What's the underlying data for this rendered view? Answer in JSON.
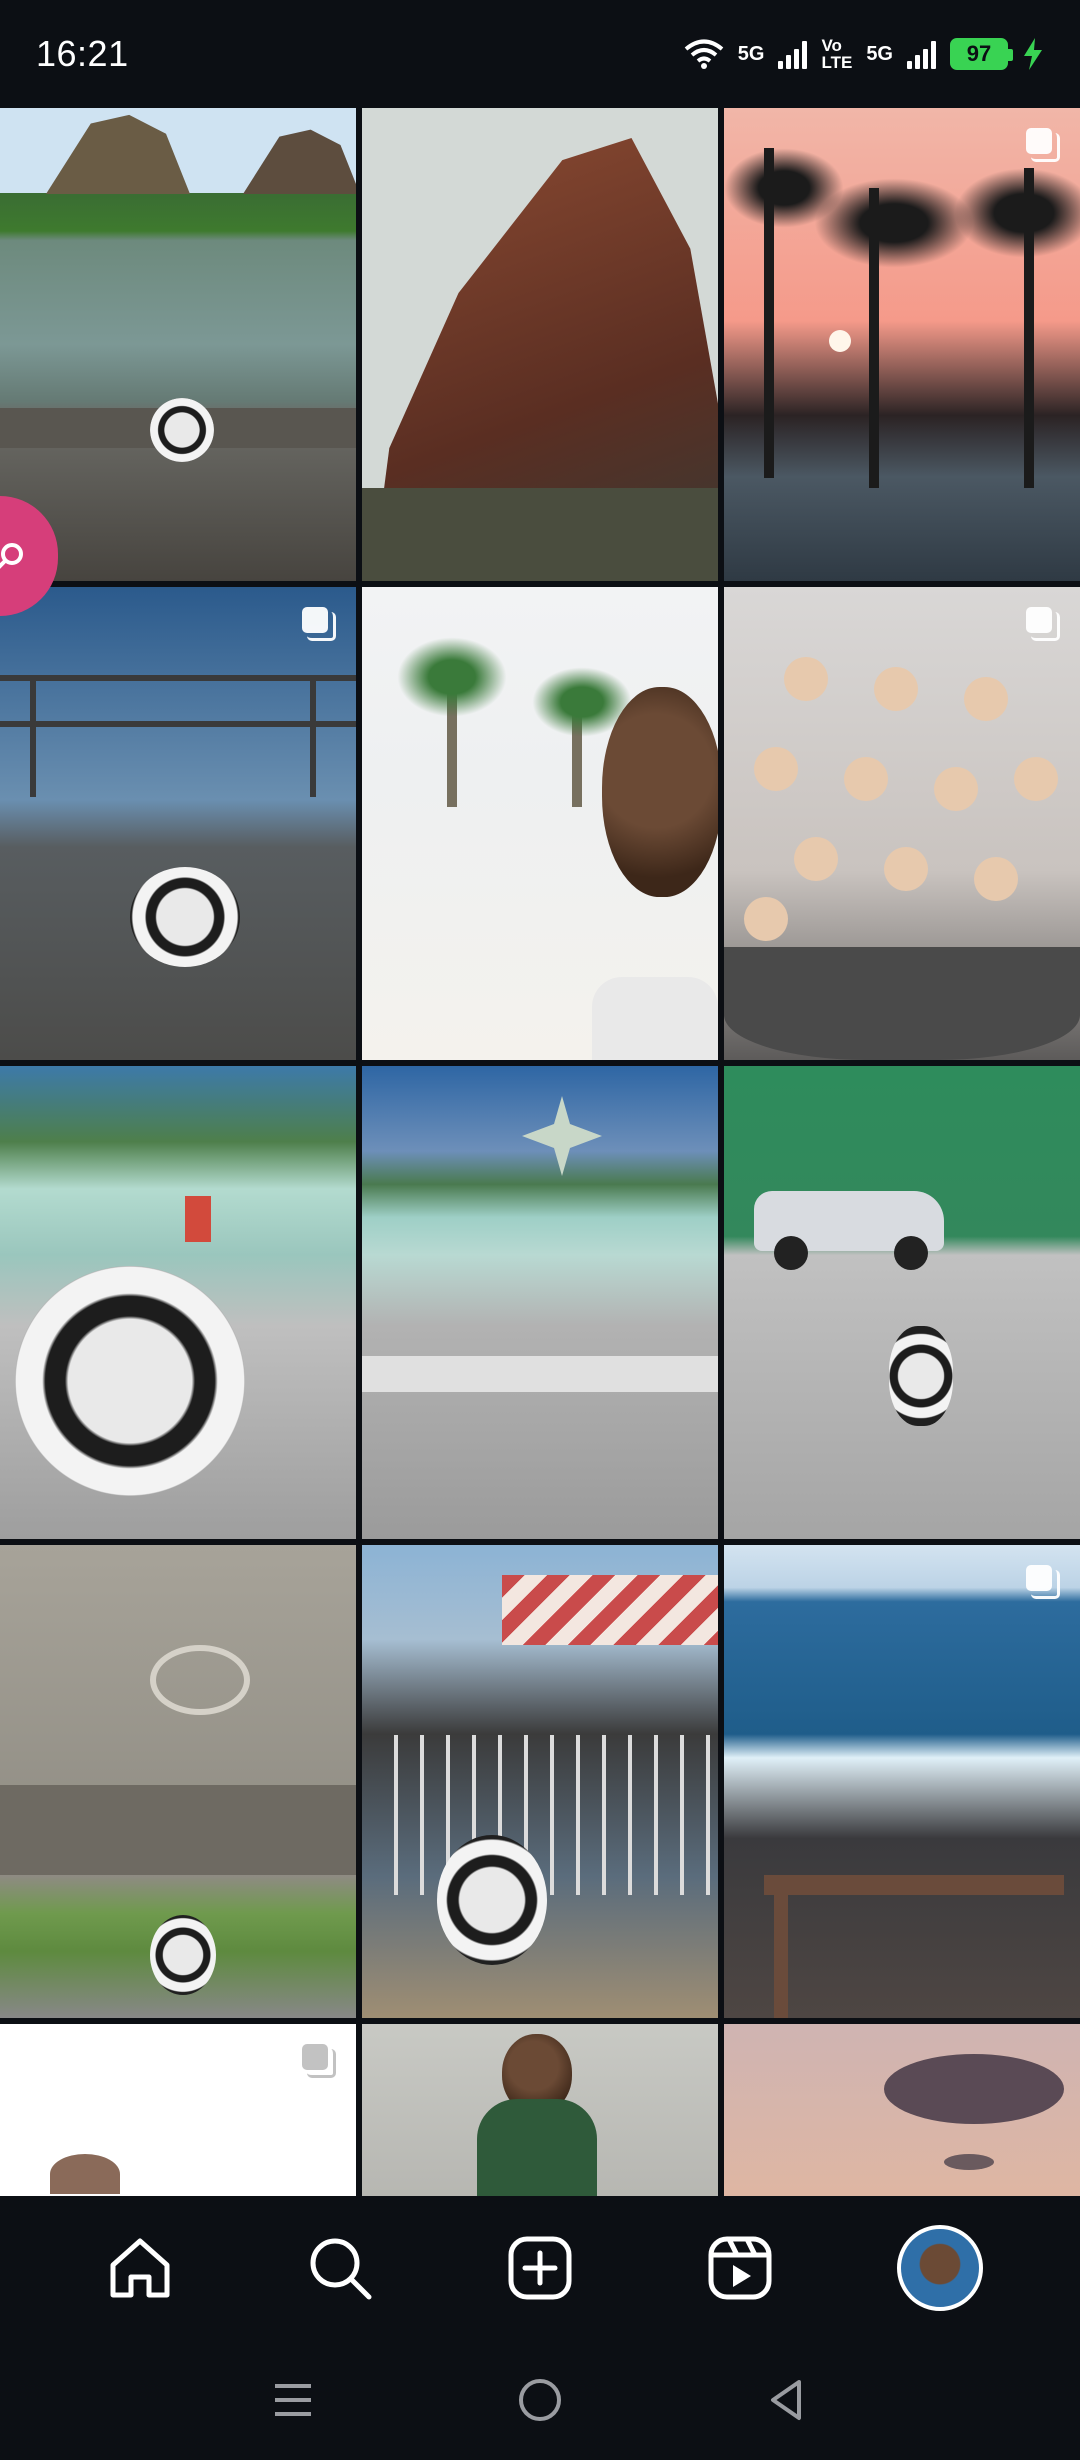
{
  "status_bar": {
    "time": "16:21",
    "net1": "5G",
    "volte_top": "Vo",
    "volte_bottom": "LTE",
    "net2": "5G",
    "battery": "97",
    "battery_color": "#39d353"
  },
  "grid": {
    "tiles": [
      {
        "subject": "Sugarloaf Mountain bay with unicycle",
        "multi": false
      },
      {
        "subject": "Rock face at dusk",
        "multi": false
      },
      {
        "subject": "Sunset behind palm trees",
        "multi": true
      },
      {
        "subject": "Unicycle by seaside railing",
        "multi": true
      },
      {
        "subject": "Beach selfie with palm trees",
        "multi": false
      },
      {
        "subject": "Meringues in a pan",
        "multi": true
      },
      {
        "subject": "Unicycle on stone ledge by pool",
        "multi": false
      },
      {
        "subject": "Fountain and star sculpture",
        "multi": false
      },
      {
        "subject": "Unicycle in front of green building",
        "multi": false
      },
      {
        "subject": "Stone fountain monument with unicycle",
        "multi": false
      },
      {
        "subject": "Ship with unicycle by railing",
        "multi": false
      },
      {
        "subject": "Ocean waves on rocks",
        "multi": true
      },
      {
        "subject": "Portrait, partially visible",
        "multi": true
      },
      {
        "subject": "Man at seaside",
        "multi": false
      },
      {
        "subject": "Sunset clouds",
        "multi": false
      }
    ]
  },
  "bottom_nav": {
    "items": [
      "home-icon",
      "search-icon",
      "create-post-icon",
      "reels-icon",
      "profile-avatar"
    ]
  },
  "system_nav": {
    "items": [
      "recent-apps-icon",
      "home-circle-icon",
      "back-icon"
    ]
  },
  "colors": {
    "background": "#0c0f14",
    "search_fab": "#d63e7a"
  }
}
